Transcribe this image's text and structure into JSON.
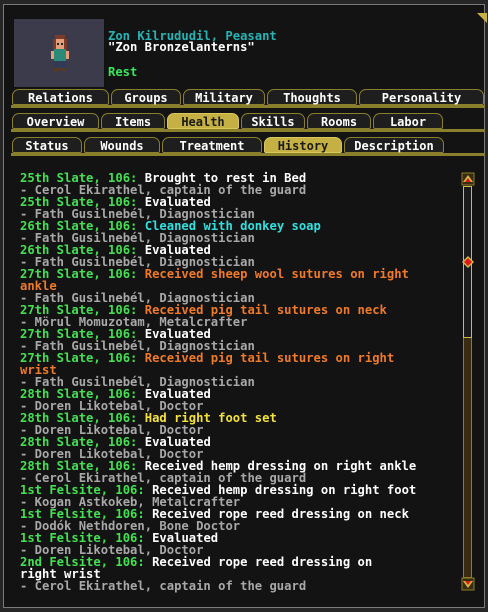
{
  "header": {
    "name": "Zon Kilrududil, Peasant",
    "nickname": "\"Zon Bronzelanterns\"",
    "status": "Rest"
  },
  "tabs_row1": [
    {
      "label": "Relations",
      "active": false
    },
    {
      "label": "Groups",
      "active": false
    },
    {
      "label": "Military",
      "active": false
    },
    {
      "label": "Thoughts",
      "active": false
    },
    {
      "label": "Personality",
      "active": false
    }
  ],
  "tabs_row2": [
    {
      "label": "Overview",
      "active": false
    },
    {
      "label": "Items",
      "active": false
    },
    {
      "label": "Health",
      "active": true
    },
    {
      "label": "Skills",
      "active": false
    },
    {
      "label": "Rooms",
      "active": false
    },
    {
      "label": "Labor",
      "active": false
    }
  ],
  "tabs_row3": [
    {
      "label": "Status",
      "active": false
    },
    {
      "label": "Wounds",
      "active": false
    },
    {
      "label": "Treatment",
      "active": false
    },
    {
      "label": "History",
      "active": true
    },
    {
      "label": "Description",
      "active": false
    }
  ],
  "history": [
    {
      "date": "25th Slate, 106:",
      "event": "Brought to rest in Bed",
      "color": "#ffffff",
      "by": "- Cerol Ekirathel, captain of the guard"
    },
    {
      "date": "25th Slate, 106:",
      "event": "Evaluated",
      "color": "#ffffff",
      "by": "- Fath Gusilnebél, Diagnostician"
    },
    {
      "date": "26th Slate, 106:",
      "event": "Cleaned with donkey soap",
      "color": "#32e0e0",
      "by": "- Fath Gusilnebél, Diagnostician"
    },
    {
      "date": "26th Slate, 106:",
      "event": "Evaluated",
      "color": "#ffffff",
      "by": "- Fath Gusilnebél, Diagnostician"
    },
    {
      "date": "27th Slate, 106:",
      "event": "Received sheep wool sutures on right",
      "event2": "ankle",
      "color": "#ef7a28",
      "by": "- Fath Gusilnebél, Diagnostician"
    },
    {
      "date": "27th Slate, 106:",
      "event": "Received pig tail sutures on neck",
      "color": "#ef7a28",
      "by": "- Mörul Momuzotam, Metalcrafter"
    },
    {
      "date": "27th Slate, 106:",
      "event": "Evaluated",
      "color": "#ffffff",
      "by": "- Fath Gusilnebél, Diagnostician"
    },
    {
      "date": "27th Slate, 106:",
      "event": "Received pig tail sutures on right",
      "event2": "wrist",
      "color": "#ef7a28",
      "by": "- Fath Gusilnebél, Diagnostician"
    },
    {
      "date": "28th Slate, 106:",
      "event": "Evaluated",
      "color": "#ffffff",
      "by": "- Doren Likotebal, Doctor"
    },
    {
      "date": "28th Slate, 106:",
      "event": "Had right foot set",
      "color": "#f2e23a",
      "by": "- Doren Likotebal, Doctor"
    },
    {
      "date": "28th Slate, 106:",
      "event": "Evaluated",
      "color": "#ffffff",
      "by": "- Doren Likotebal, Doctor"
    },
    {
      "date": "28th Slate, 106:",
      "event": "Received hemp dressing on right ankle",
      "color": "#ffffff",
      "by": "- Cerol Ekirathel, captain of the guard"
    },
    {
      "date": "1st Felsite, 106:",
      "event": "Received hemp dressing on right foot",
      "color": "#ffffff",
      "by": "- Kogan Astkokeb, Metalcrafter"
    },
    {
      "date": "1st Felsite, 106:",
      "event": "Received rope reed dressing on neck",
      "color": "#ffffff",
      "by": "- Dodók Nethdoren, Bone Doctor"
    },
    {
      "date": "1st Felsite, 106:",
      "event": "Evaluated",
      "color": "#ffffff",
      "by": "- Doren Likotebal, Doctor"
    },
    {
      "date": "2nd Felsite, 106:",
      "event": "Received rope reed dressing on",
      "event2": "right wrist",
      "color": "#ffffff",
      "by": "- Cerol Ekirathel, captain of the guard"
    }
  ],
  "colors": {
    "date": "#45e052",
    "caregiver": "#a8a8a8",
    "tab_border": "#8a7f2b",
    "tab_active": "#c5b043"
  },
  "scroll": {
    "position_fraction": 0.0,
    "visible_fraction": 0.39
  }
}
